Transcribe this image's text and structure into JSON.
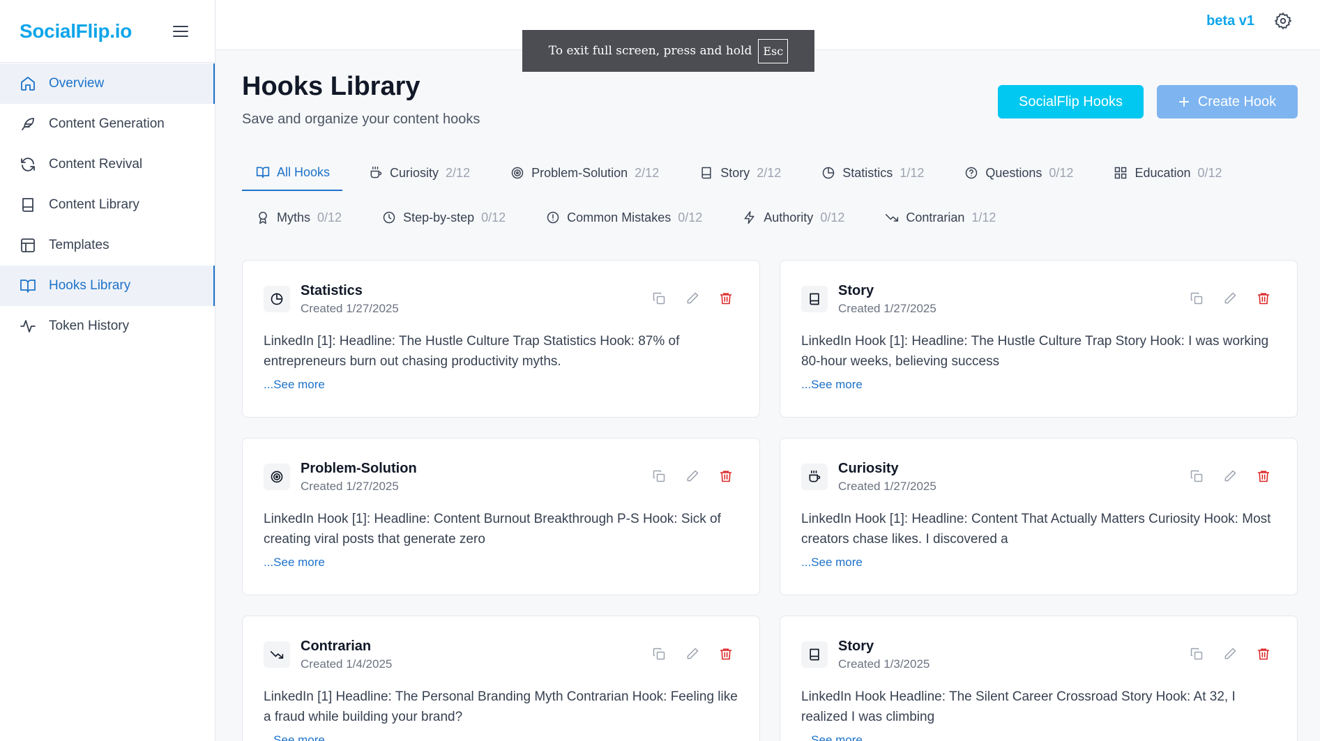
{
  "app": {
    "logo": "SocialFlip.io",
    "version": "beta v1"
  },
  "sidebar": {
    "items": [
      {
        "label": "Overview",
        "icon": "home-icon"
      },
      {
        "label": "Content Generation",
        "icon": "feather-icon"
      },
      {
        "label": "Content Revival",
        "icon": "refresh-icon"
      },
      {
        "label": "Content Library",
        "icon": "book-icon"
      },
      {
        "label": "Templates",
        "icon": "layout-icon"
      },
      {
        "label": "Hooks Library",
        "icon": "open-book-icon"
      },
      {
        "label": "Token History",
        "icon": "activity-icon"
      }
    ]
  },
  "fullscreen_banner": {
    "text": "To exit full screen, press and hold",
    "key": "Esc"
  },
  "header": {
    "title": "Hooks Library",
    "subtitle": "Save and organize your content hooks",
    "socialflip_hooks_button": "SocialFlip Hooks",
    "create_hook_button": "Create Hook"
  },
  "tabs": [
    {
      "label": "All Hooks",
      "count": "",
      "icon": "open-book-icon"
    },
    {
      "label": "Curiosity",
      "count": "2/12",
      "icon": "coffee-icon"
    },
    {
      "label": "Problem-Solution",
      "count": "2/12",
      "icon": "target-icon"
    },
    {
      "label": "Story",
      "count": "2/12",
      "icon": "book-icon"
    },
    {
      "label": "Statistics",
      "count": "1/12",
      "icon": "pie-chart-icon"
    },
    {
      "label": "Questions",
      "count": "0/12",
      "icon": "help-circle-icon"
    },
    {
      "label": "Education",
      "count": "0/12",
      "icon": "grid-icon"
    },
    {
      "label": "Myths",
      "count": "0/12",
      "icon": "award-icon"
    },
    {
      "label": "Step-by-step",
      "count": "0/12",
      "icon": "clock-icon"
    },
    {
      "label": "Common Mistakes",
      "count": "0/12",
      "icon": "alert-circle-icon"
    },
    {
      "label": "Authority",
      "count": "0/12",
      "icon": "zap-icon"
    },
    {
      "label": "Contrarian",
      "count": "1/12",
      "icon": "trending-down-icon"
    }
  ],
  "cards": [
    {
      "type": "Statistics",
      "icon": "pie-chart-icon",
      "created": "Created 1/27/2025",
      "text": "LinkedIn [1]: Headline: The Hustle Culture Trap Statistics Hook: 87% of entrepreneurs burn out chasing productivity myths.",
      "see_more": "...See more"
    },
    {
      "type": "Story",
      "icon": "book-icon",
      "created": "Created 1/27/2025",
      "text": "LinkedIn Hook [1]: Headline: The Hustle Culture Trap Story Hook: I was working 80-hour weeks, believing success",
      "see_more": "...See more"
    },
    {
      "type": "Problem-Solution",
      "icon": "target-icon",
      "created": "Created 1/27/2025",
      "text": "LinkedIn Hook [1]: Headline: Content Burnout Breakthrough P-S Hook: Sick of creating viral posts that generate zero",
      "see_more": "...See more"
    },
    {
      "type": "Curiosity",
      "icon": "coffee-icon",
      "created": "Created 1/27/2025",
      "text": "LinkedIn Hook [1]: Headline: Content That Actually Matters Curiosity Hook: Most creators chase likes. I discovered a",
      "see_more": "...See more"
    },
    {
      "type": "Contrarian",
      "icon": "trending-down-icon",
      "created": "Created 1/4/2025",
      "text": "LinkedIn [1] Headline: The Personal Branding Myth Contrarian Hook: Feeling like a fraud while building your brand?",
      "see_more": "...See more"
    },
    {
      "type": "Story",
      "icon": "book-icon",
      "created": "Created 1/3/2025",
      "text": "LinkedIn Hook Headline: The Silent Career Crossroad Story Hook: At 32, I realized I was climbing",
      "see_more": "...See more"
    }
  ],
  "colors": {
    "brand": "#0ea5e9",
    "active_blue": "#1d72c9",
    "hooks_button": "#00c8f0",
    "create_button": "#7eb4f0",
    "delete_red": "#dc2626"
  }
}
